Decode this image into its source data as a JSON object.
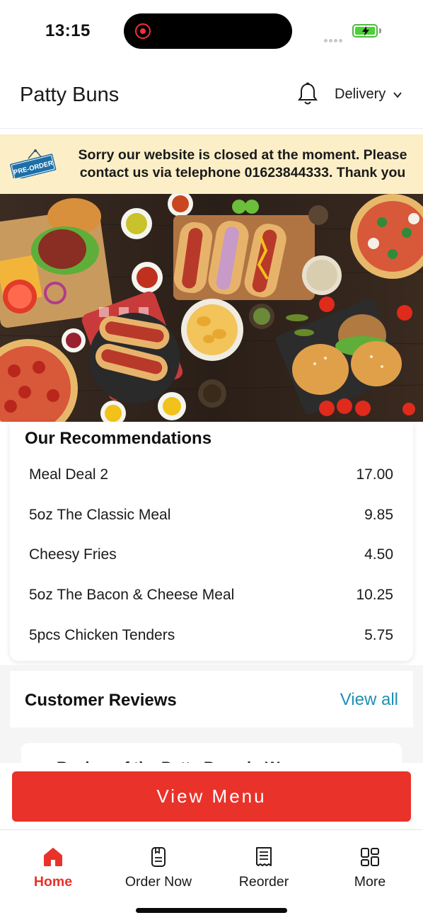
{
  "status_bar": {
    "time": "13:15",
    "battery_icon": "battery-charging-icon",
    "battery_color": "#4cd137"
  },
  "header": {
    "title": "Patty Buns",
    "notification_icon": "bell-icon",
    "order_type": "Delivery"
  },
  "notice": {
    "tag_text": "PRE-ORDER",
    "message": "Sorry our website is closed at the moment. Please contact us via telephone 01623844333. Thank you",
    "background": "#fcefc7"
  },
  "recommendations": {
    "title": "Our Recommendations",
    "items": [
      {
        "name": "Meal Deal 2",
        "price": "17.00"
      },
      {
        "name": "5oz The Classic Meal",
        "price": "9.85"
      },
      {
        "name": "Cheesy Fries",
        "price": "4.50"
      },
      {
        "name": "5oz The Bacon & Cheese Meal",
        "price": "10.25"
      },
      {
        "name": "5pcs Chicken Tenders",
        "price": "5.75"
      }
    ]
  },
  "reviews": {
    "title": "Customer Reviews",
    "view_all": "View all",
    "first_review_title": "Review of the Patty Buns in W..."
  },
  "cta": {
    "label": "View Menu",
    "color": "#e9322a"
  },
  "bottom_nav": {
    "items": [
      {
        "label": "Home",
        "icon": "home-icon",
        "active": true
      },
      {
        "label": "Order Now",
        "icon": "order-icon",
        "active": false
      },
      {
        "label": "Reorder",
        "icon": "receipt-icon",
        "active": false
      },
      {
        "label": "More",
        "icon": "grid-icon",
        "active": false
      }
    ],
    "accent": "#e9322a"
  }
}
